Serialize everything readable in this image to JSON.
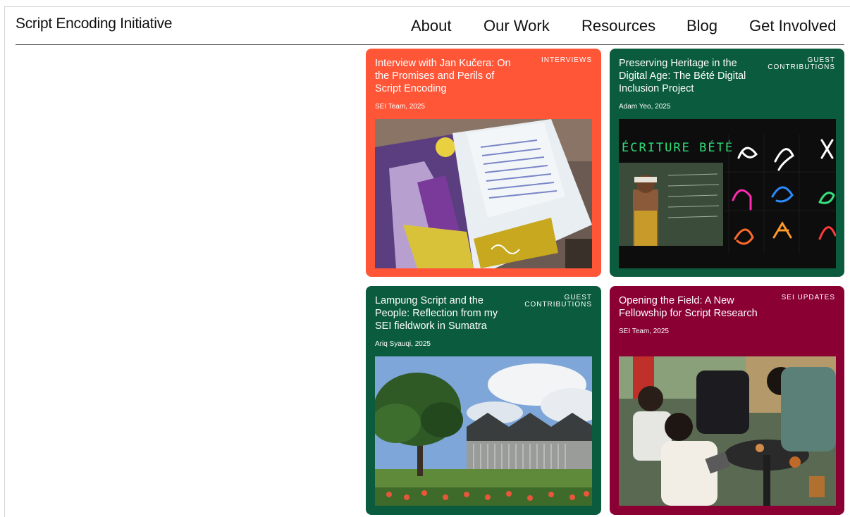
{
  "site": {
    "title": "Script Encoding Initiative"
  },
  "nav": {
    "items": [
      {
        "label": "About"
      },
      {
        "label": "Our Work"
      },
      {
        "label": "Resources"
      },
      {
        "label": "Blog"
      },
      {
        "label": "Get Involved"
      }
    ]
  },
  "colors": {
    "interviews": "#ff5638",
    "guest": "#0b5b3f",
    "sei_updates": "#8a0033"
  },
  "cards": [
    {
      "title": "Interview with Jan Kučera: On the Promises and Perils of Script Encoding",
      "tag": "Interviews",
      "byline": "SEI Team, 2025",
      "image_icon": "open-notebook-photo"
    },
    {
      "title": "Preserving Heritage in the Digital Age: The Bété Digital Inclusion Project",
      "tag": "Guest Contributions",
      "byline": "Adam Yeo, 2025",
      "image_caption": "ÉCRITURE BÉTÉ",
      "image_icon": "bete-script-poster"
    },
    {
      "title": "Lampung Script and the People: Reflection from my SEI fieldwork in Sumatra",
      "tag": "Guest Contributions",
      "byline": "Ariq Syauqi, 2025",
      "image_icon": "building-with-tree-photo"
    },
    {
      "title": "Opening the Field: A New Fellowship for Script Research",
      "tag": "SEI Updates",
      "byline": "SEI Team, 2025",
      "image_icon": "people-at-table-photo"
    }
  ]
}
